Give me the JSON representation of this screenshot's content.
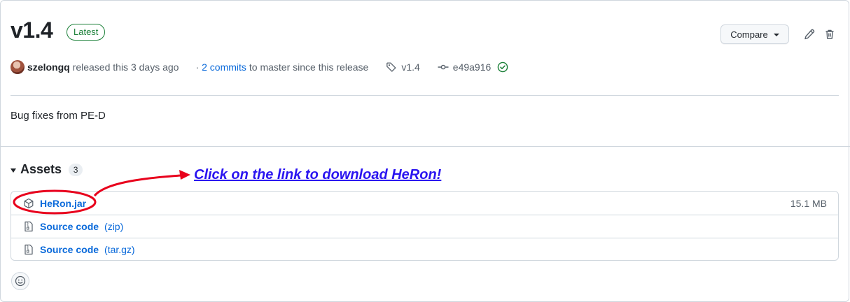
{
  "release": {
    "title": "v1.4",
    "badge": "Latest",
    "compare_label": "Compare",
    "author": "szelongq",
    "released_text": "released this 3 days ago",
    "bullet": "·",
    "commits_link": "2 commits",
    "commits_suffix": "to master since this release",
    "tag": "v1.4",
    "commit_hash": "e49a916",
    "body": "Bug fixes from PE-D"
  },
  "assets": {
    "heading": "Assets",
    "count": "3",
    "items": [
      {
        "name": "HeRon.jar",
        "ext": "",
        "size": "15.1 MB",
        "icon": "package-icon"
      },
      {
        "name": "Source code",
        "ext": "(zip)",
        "size": "",
        "icon": "file-zip-icon"
      },
      {
        "name": "Source code",
        "ext": "(tar.gz)",
        "size": "",
        "icon": "file-zip-icon"
      }
    ]
  },
  "annotation": {
    "text": "Click on the link to download HeRon!",
    "color": "#2a14f0",
    "marker_color": "#e8001c"
  },
  "colors": {
    "link": "#0969da",
    "success": "#1a7f37",
    "border": "#d0d7de",
    "muted": "#57606a"
  }
}
